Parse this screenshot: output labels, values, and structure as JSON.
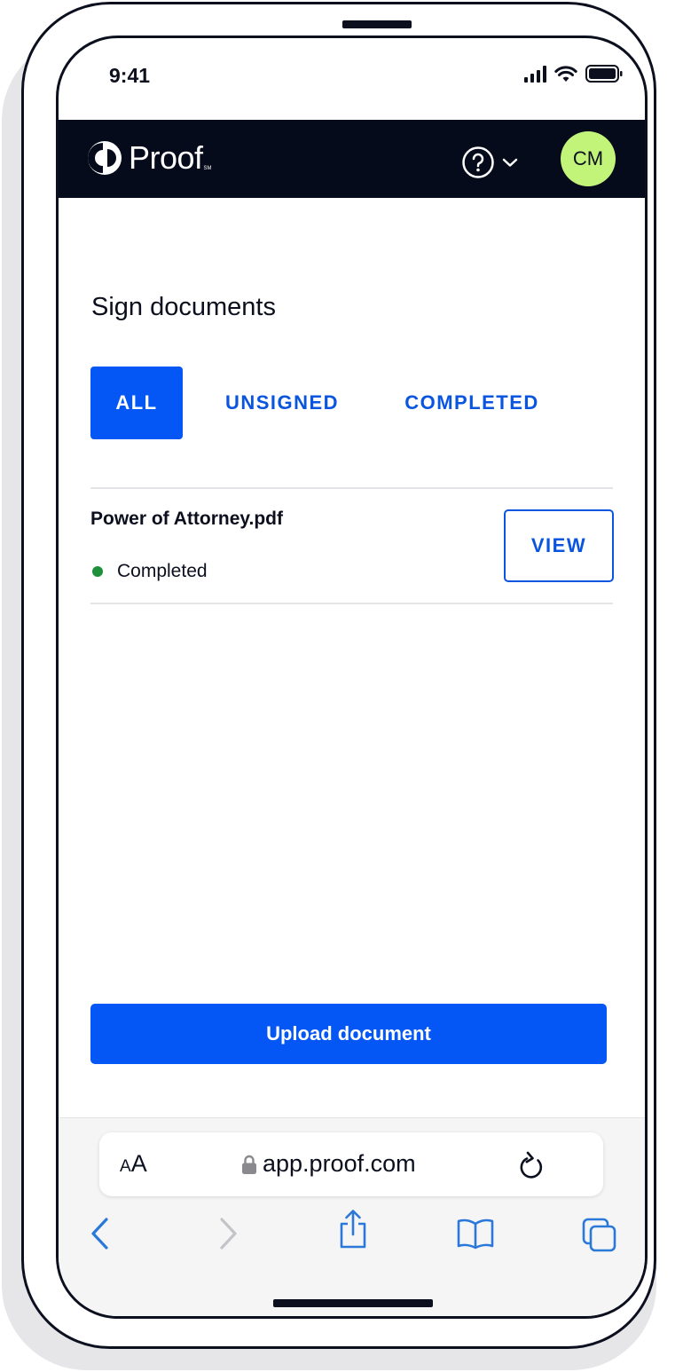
{
  "status_bar": {
    "time": "9:41"
  },
  "header": {
    "logo_text": "Proof",
    "logo_mark": "SM",
    "help_icon": "question-circle-icon",
    "avatar_initials": "CM"
  },
  "main": {
    "title": "Sign documents",
    "tabs": [
      {
        "label": "ALL",
        "active": true
      },
      {
        "label": "UNSIGNED",
        "active": false
      },
      {
        "label": "COMPLETED",
        "active": false
      }
    ],
    "documents": [
      {
        "name": "Power of Attorney.pdf",
        "status": "Completed",
        "action": "VIEW"
      }
    ],
    "upload_label": "Upload document"
  },
  "browser": {
    "text_size_label": "AA",
    "url": "app.proof.com"
  },
  "colors": {
    "primary": "#0557f5",
    "header_bg": "#060b1c",
    "avatar_bg": "#c3f47a",
    "status_completed": "#1e8f3a"
  }
}
